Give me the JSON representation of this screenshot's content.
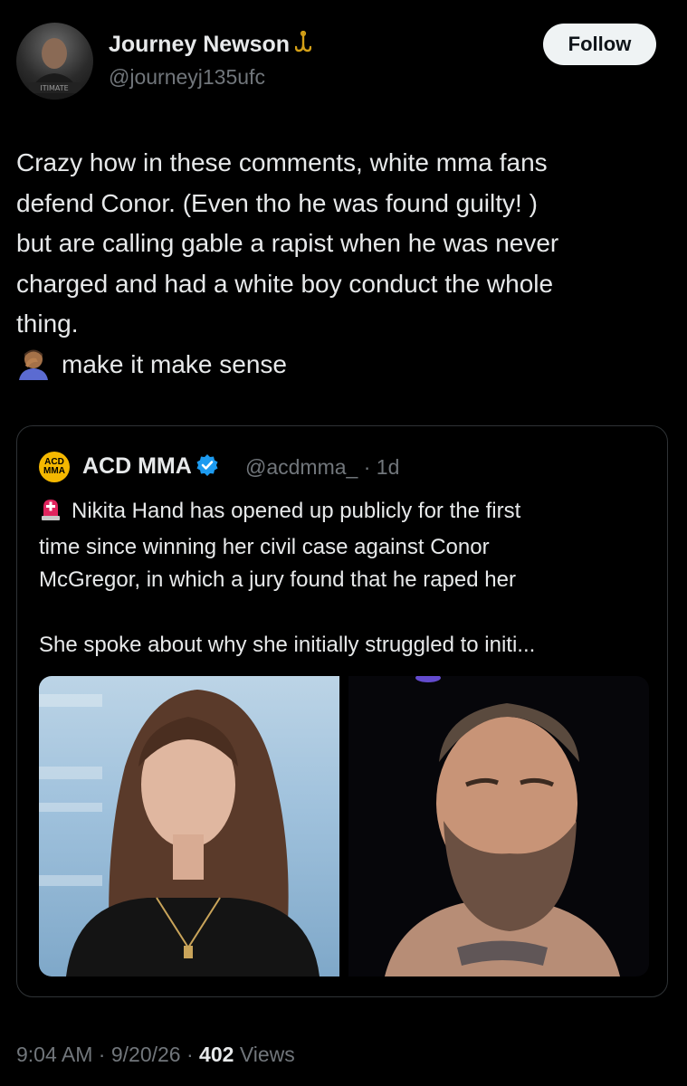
{
  "author": {
    "name": "Journey Newson",
    "handle": "@journeyj135ufc",
    "avatar_icon": "avatar-photo",
    "badge_icon": "fishhook-icon"
  },
  "follow_label": "Follow",
  "tweet": {
    "lines": [
      "Crazy how in these comments, white mma fans",
      "defend Conor. (Even tho he was found guilty!  )",
      "but are calling gable a rapist when he was never",
      "charged and had a white boy conduct the whole",
      "thing."
    ],
    "last_line": "make it make sense",
    "emoji_icon": "facepalm-emoji"
  },
  "quote": {
    "logo_text": "ACD MMA",
    "name": "ACD MMA",
    "handle_time": "@acdmma_ · 1d",
    "text_lines": [
      "Nikita Hand has opened up publicly for the first",
      "time since winning her civil case against Conor",
      "McGregor, in which a jury found that he raped her"
    ],
    "text_truncated": "She spoke about why she initially struggled to initi...",
    "siren_icon": "siren-emoji",
    "verified_icon": "verified-badge-icon"
  },
  "meta": {
    "time": "9:04 AM",
    "date": "9/20/26",
    "views_count": "402",
    "views_label": "Views"
  },
  "colors": {
    "background": "#000000",
    "text": "#e7e9ea",
    "secondary": "#71767b",
    "border": "#2f3336",
    "verified": "#1d9bf0"
  }
}
